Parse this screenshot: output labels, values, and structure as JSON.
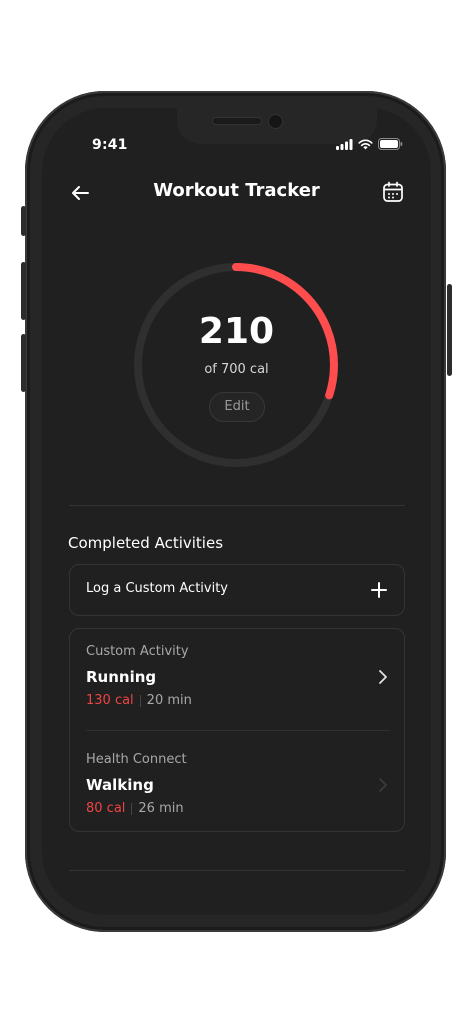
{
  "status_bar": {
    "time": "9:41"
  },
  "header": {
    "title": "Workout Tracker"
  },
  "progress": {
    "value": "210",
    "target_label": "of 700 cal",
    "edit_label": "Edit",
    "current": 210,
    "goal": 700
  },
  "activities": {
    "section_title": "Completed Activities",
    "log_custom_label": "Log a Custom Activity",
    "items": [
      {
        "source": "Custom Activity",
        "name": "Running",
        "calories": "130 cal",
        "duration": "20 min"
      },
      {
        "source": "Health Connect",
        "name": "Walking",
        "calories": "80 cal",
        "duration": "26 min"
      }
    ]
  },
  "colors": {
    "accent": "#ff4d4d",
    "ring_track": "#2f2f2f",
    "background": "#202020",
    "card_border": "#343434"
  },
  "icons": [
    "back-arrow-icon",
    "calendar-icon",
    "plus-icon",
    "chevron-right-icon",
    "signal-icon",
    "wifi-icon",
    "battery-icon"
  ]
}
